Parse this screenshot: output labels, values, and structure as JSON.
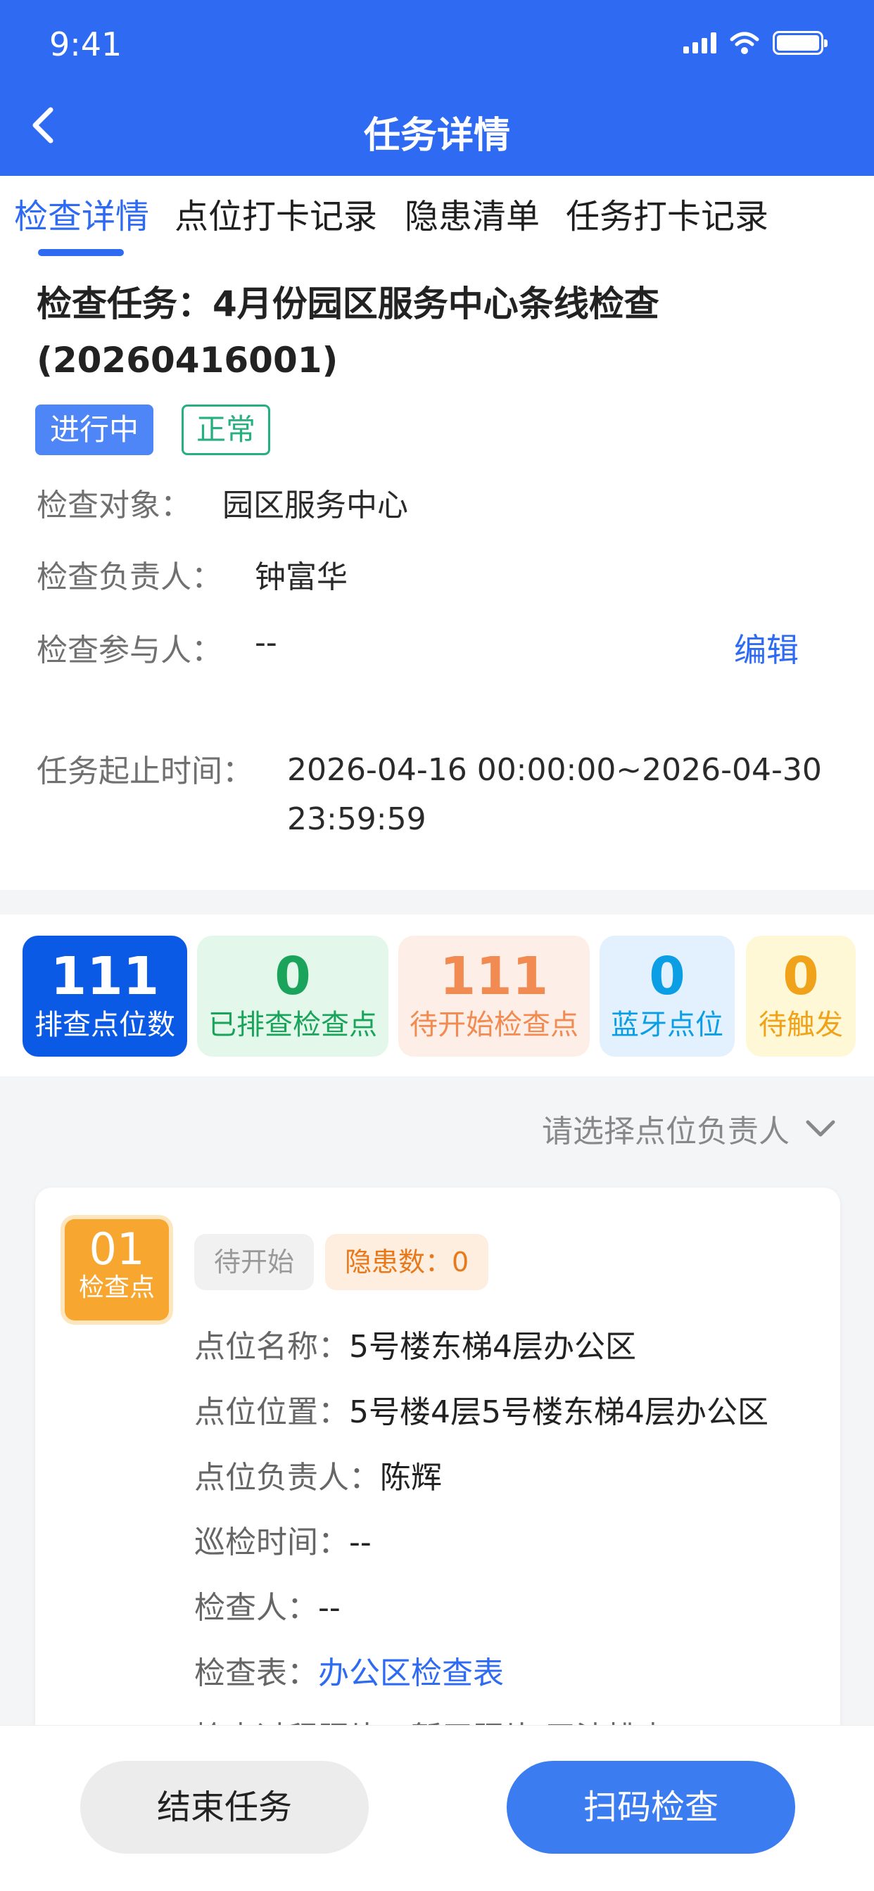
{
  "status_bar": {
    "time": "9:41"
  },
  "header": {
    "title": "任务详情"
  },
  "tabs": [
    "检查详情",
    "点位打卡记录",
    "隐患清单",
    "任务打卡记录"
  ],
  "task": {
    "title": "检查任务：4月份园区服务中心条线检查(20260416001)",
    "status_tag": "进行中",
    "condition_tag": "正常",
    "fields": {
      "object_label": "检查对象：",
      "object_value": "园区服务中心",
      "owner_label": "检查负责人：",
      "owner_value": "钟富华",
      "participants_label": "检查参与人：",
      "participants_value": "--",
      "edit_label": "编辑",
      "time_label": "任务起止时间：",
      "time_value": "2026-04-16 00:00:00~2026-04-30 23:59:59"
    }
  },
  "stats": [
    {
      "value": "111",
      "label": "排查点位数"
    },
    {
      "value": "0",
      "label": "已排查检查点"
    },
    {
      "value": "111",
      "label": "待开始检查点"
    },
    {
      "value": "0",
      "label": "蓝牙点位"
    },
    {
      "value": "0",
      "label": "待触发"
    }
  ],
  "filter": {
    "placeholder": "请选择点位负责人"
  },
  "checkpoint": {
    "badge_number": "01",
    "badge_label": "检查点",
    "status_chip": "待开始",
    "hazard_chip": "隐患数：0",
    "rows": [
      {
        "key": "点位名称：",
        "value": "5号楼东梯4层办公区"
      },
      {
        "key": "点位位置：",
        "value": "5号楼4层5号楼东梯4层办公区"
      },
      {
        "key": "点位负责人：",
        "value": "陈辉"
      },
      {
        "key": "巡检时间：",
        "value": "--"
      },
      {
        "key": "检查人：",
        "value": "--"
      },
      {
        "key": "检查表：",
        "value": "办公区检查表"
      }
    ],
    "partial_row": "检查过程照片：暂无照片 无法排查"
  },
  "actions": {
    "end": "结束任务",
    "scan": "扫码检查"
  }
}
